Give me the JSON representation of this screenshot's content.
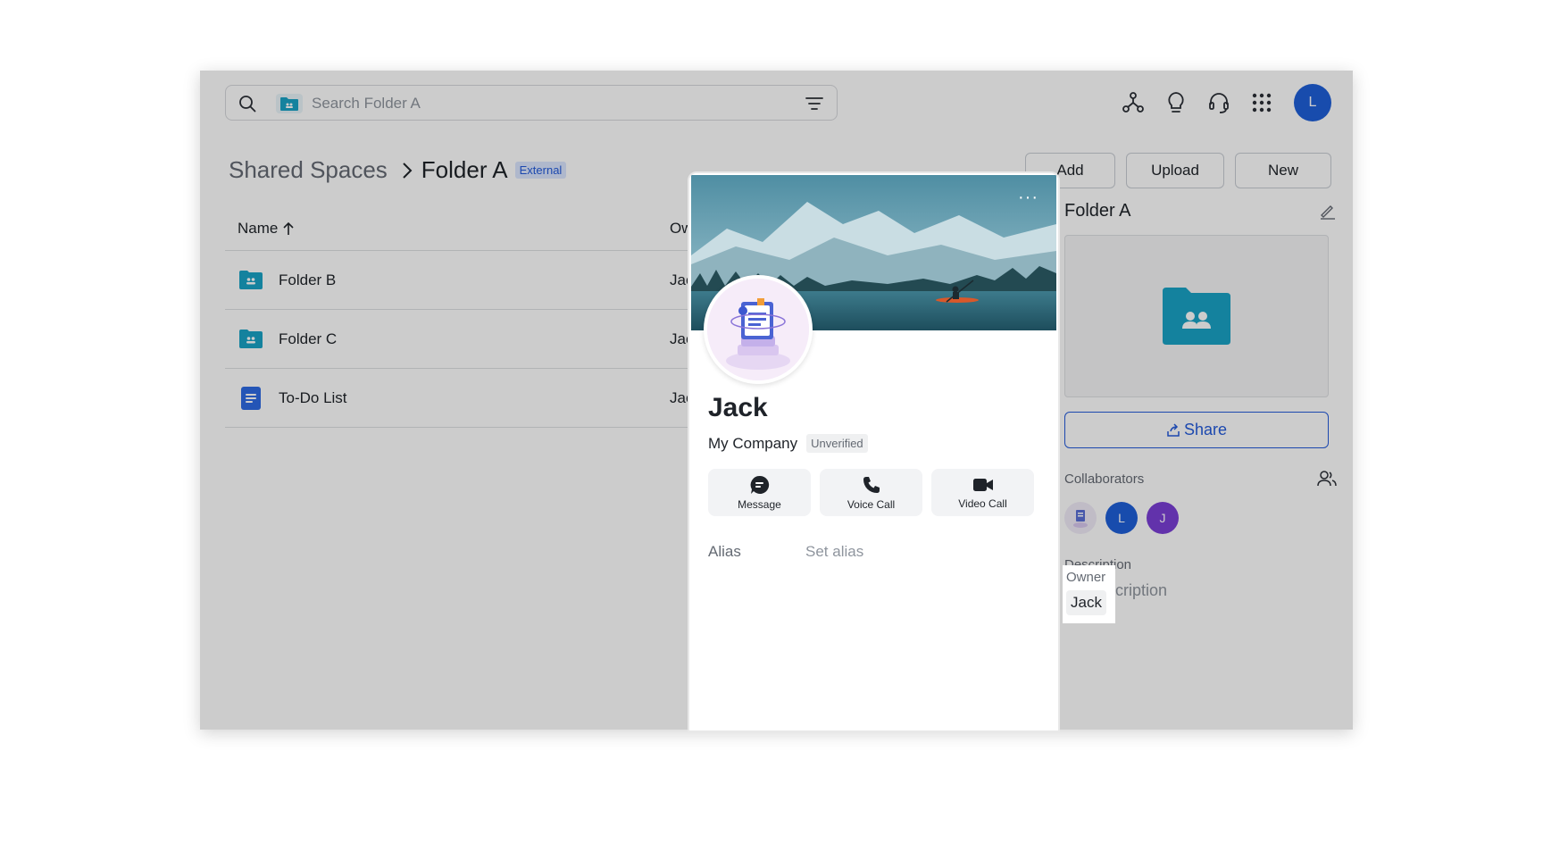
{
  "search": {
    "placeholder": "Search Folder A"
  },
  "header": {
    "avatar_initial": "L"
  },
  "breadcrumb": {
    "root": "Shared Spaces",
    "current": "Folder A",
    "badge": "External"
  },
  "toolbar": {
    "add_label": "Add",
    "upload_label": "Upload",
    "new_label": "New"
  },
  "table": {
    "columns": {
      "name": "Name",
      "owner": "Ow"
    },
    "rows": [
      {
        "name": "Folder B",
        "owner": "Jac",
        "icon": "shared-folder-icon"
      },
      {
        "name": "Folder C",
        "owner": "Jac",
        "icon": "shared-folder-icon"
      },
      {
        "name": "To-Do List",
        "owner": "Jac",
        "icon": "doc-icon"
      }
    ]
  },
  "info_panel": {
    "title": "Folder A",
    "share_label": "Share",
    "collaborators_label": "Collaborators",
    "collaborators": [
      "L",
      "J"
    ],
    "description_label": "Description",
    "description_value": "No description",
    "owner_label": "Owner",
    "owner_value": "Jack"
  },
  "profile": {
    "name": "Jack",
    "company": "My Company",
    "verification": "Unverified",
    "actions": {
      "message": "Message",
      "voice_call": "Voice Call",
      "video_call": "Video Call"
    },
    "alias_label": "Alias",
    "alias_value": "Set alias"
  },
  "colors": {
    "accent": "#245bdb",
    "folder": "#1aa3c6",
    "doc": "#2d6be4",
    "avatar_l": "#1f5fd9",
    "avatar_j": "#7b3fd6"
  }
}
